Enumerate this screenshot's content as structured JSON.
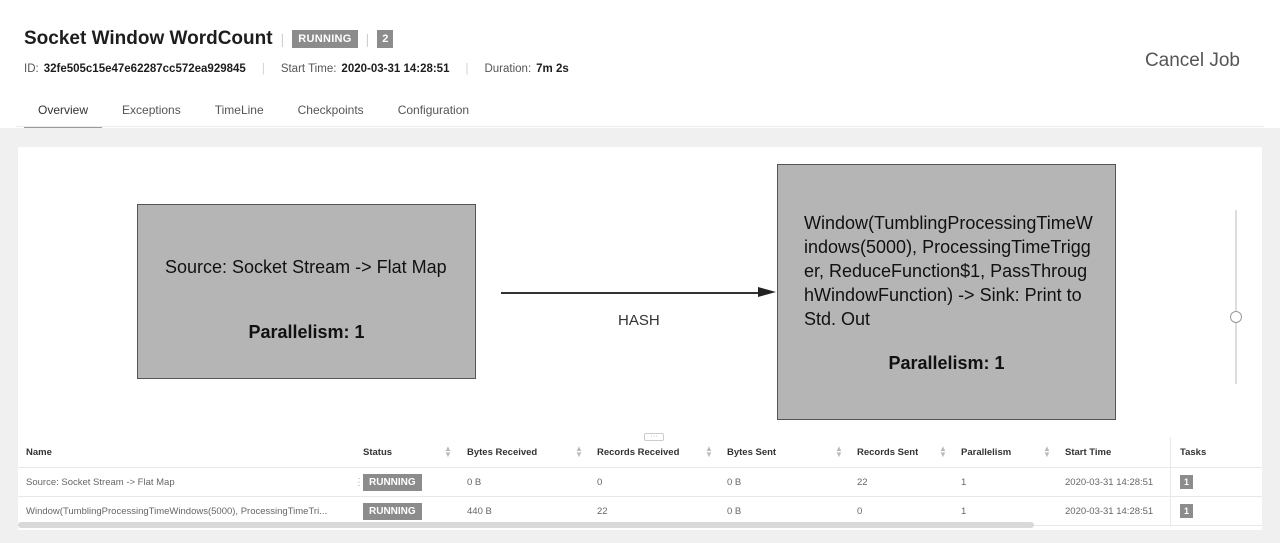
{
  "header": {
    "title": "Socket Window WordCount",
    "status": "RUNNING",
    "parallel_count": "2",
    "id_label": "ID:",
    "id_value": "32fe505c15e47e62287cc572ea929845",
    "start_label": "Start Time:",
    "start_value": "2020-03-31 14:28:51",
    "duration_label": "Duration:",
    "duration_value": "7m 2s",
    "cancel_label": "Cancel Job"
  },
  "tabs": [
    {
      "label": "Overview",
      "active": true
    },
    {
      "label": "Exceptions"
    },
    {
      "label": "TimeLine"
    },
    {
      "label": "Checkpoints"
    },
    {
      "label": "Configuration"
    }
  ],
  "graph": {
    "nodes": [
      {
        "name": "Source: Socket Stream -> Flat Map",
        "parallelism": "Parallelism: 1"
      },
      {
        "name": "Window(TumblingProcessingTimeWindows(5000), ProcessingTimeTrigger, ReduceFunction$1, PassThroughWindowFunction) -> Sink: Print to Std. Out",
        "parallelism": "Parallelism: 1"
      }
    ],
    "edge_label": "HASH"
  },
  "table": {
    "headers": {
      "name": "Name",
      "status": "Status",
      "bytes_received": "Bytes Received",
      "records_received": "Records Received",
      "bytes_sent": "Bytes Sent",
      "records_sent": "Records Sent",
      "parallelism": "Parallelism",
      "start_time": "Start Time",
      "tasks": "Tasks"
    },
    "rows": [
      {
        "name": "Source: Socket Stream -> Flat Map",
        "status": "RUNNING",
        "bytes_received": "0 B",
        "records_received": "0",
        "bytes_sent": "0 B",
        "records_sent": "22",
        "parallelism": "1",
        "start_time": "2020-03-31 14:28:51",
        "tasks": "1"
      },
      {
        "name": "Window(TumblingProcessingTimeWindows(5000), ProcessingTimeTri...",
        "status": "RUNNING",
        "bytes_received": "440 B",
        "records_received": "22",
        "bytes_sent": "0 B",
        "records_sent": "0",
        "parallelism": "1",
        "start_time": "2020-03-31 14:28:51",
        "tasks": "1"
      }
    ]
  },
  "icons": {
    "sort": "sort-icon",
    "resize": "resize-handle-icon",
    "zoom": "zoom-slider-icon"
  },
  "colors": {
    "node_fill": "#b5b5b5",
    "badge": "#8c8c8c"
  }
}
